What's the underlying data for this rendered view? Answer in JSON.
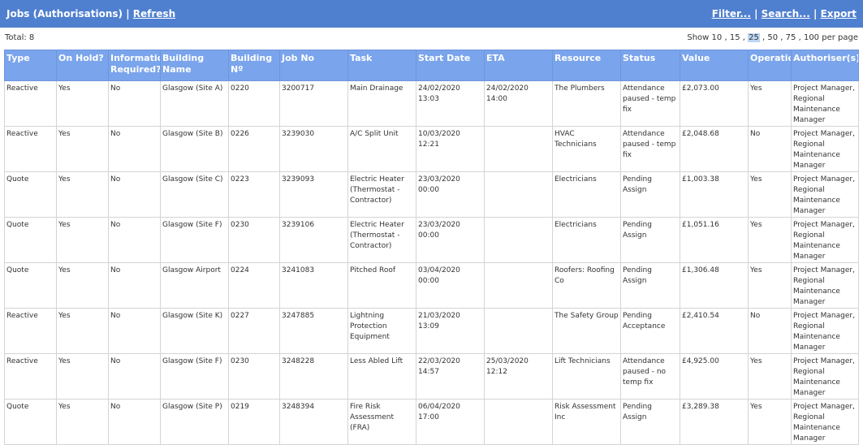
{
  "header": {
    "title": "Jobs (Authorisations)",
    "separator": "|",
    "refresh": "Refresh",
    "filter": "Filter...",
    "search": "Search...",
    "export": "Export"
  },
  "summary": {
    "total": "Total: 8",
    "show_label": "Show",
    "page_sizes": [
      "10",
      "15",
      "25",
      "50",
      "75",
      "100"
    ],
    "selected_page_size": "25",
    "per_page_label": "per page"
  },
  "table": {
    "columns": [
      "Type",
      "On Hold?",
      "Information Required?",
      "Building Name",
      "Building Nº",
      "Job No",
      "Task",
      "Start Date",
      "ETA",
      "Resource",
      "Status",
      "Value",
      "Operational",
      "Authoriser(s)"
    ],
    "rows": [
      [
        "Reactive",
        "Yes",
        "No",
        "Glasgow (Site A)",
        "0220",
        "3200717",
        "Main Drainage",
        "24/02/2020 13:03",
        "24/02/2020 14:00",
        "The Plumbers",
        "Attendance paused - temp fix",
        "£2,073.00",
        "Yes",
        "Project Manager, Regional Maintenance Manager"
      ],
      [
        "Reactive",
        "Yes",
        "No",
        "Glasgow (Site B)",
        "0226",
        "3239030",
        "A/C Split Unit",
        "10/03/2020 12:21",
        "",
        "HVAC Technicians",
        "Attendance paused - temp fix",
        "£2,048.68",
        "No",
        "Project Manager, Regional Maintenance Manager"
      ],
      [
        "Quote",
        "Yes",
        "No",
        "Glasgow (Site C)",
        "0223",
        "3239093",
        "Electric Heater (Thermostat - Contractor)",
        "23/03/2020 00:00",
        "",
        "Electricians",
        "Pending Assign",
        "£1,003.38",
        "Yes",
        "Project Manager, Regional Maintenance Manager"
      ],
      [
        "Quote",
        "Yes",
        "No",
        "Glasgow (Site F)",
        "0230",
        "3239106",
        "Electric Heater (Thermostat - Contractor)",
        "23/03/2020 00:00",
        "",
        "Electricians",
        "Pending Assign",
        "£1,051.16",
        "Yes",
        "Project Manager, Regional Maintenance Manager"
      ],
      [
        "Quote",
        "Yes",
        "No",
        "Glasgow Airport",
        "0224",
        "3241083",
        "Pitched Roof",
        "03/04/2020 00:00",
        "",
        "Roofers: Roofing Co",
        "Pending Assign",
        "£1,306.48",
        "Yes",
        "Project Manager, Regional Maintenance Manager"
      ],
      [
        "Reactive",
        "Yes",
        "No",
        "Glasgow (Site K)",
        "0227",
        "3247885",
        "Lightning Protection Equipment",
        "21/03/2020 13:09",
        "",
        "The Safety Group",
        "Pending Acceptance",
        "£2,410.54",
        "No",
        "Project Manager, Regional Maintenance Manager"
      ],
      [
        "Reactive",
        "Yes",
        "No",
        "Glasgow (Site F)",
        "0230",
        "3248228",
        "Less Abled Lift",
        "22/03/2020 14:57",
        "25/03/2020 12:12",
        "Lift Technicians",
        "Attendance paused - no temp fix",
        "£4,925.00",
        "Yes",
        "Project Manager, Regional Maintenance Manager"
      ],
      [
        "Quote",
        "Yes",
        "No",
        "Glasgow (Site P)",
        "0219",
        "3248394",
        "Fire Risk Assessment (FRA)",
        "06/04/2020 17:00",
        "",
        "Risk Assessment Inc",
        "Pending Assign",
        "£3,289.38",
        "Yes",
        "Project Manager, Regional Maintenance Manager"
      ]
    ]
  },
  "colors": {
    "header_bg": "#4f7fcf",
    "table_header_bg": "#7aa4eb",
    "selected_page_size_bg": "#bcd6f5"
  }
}
